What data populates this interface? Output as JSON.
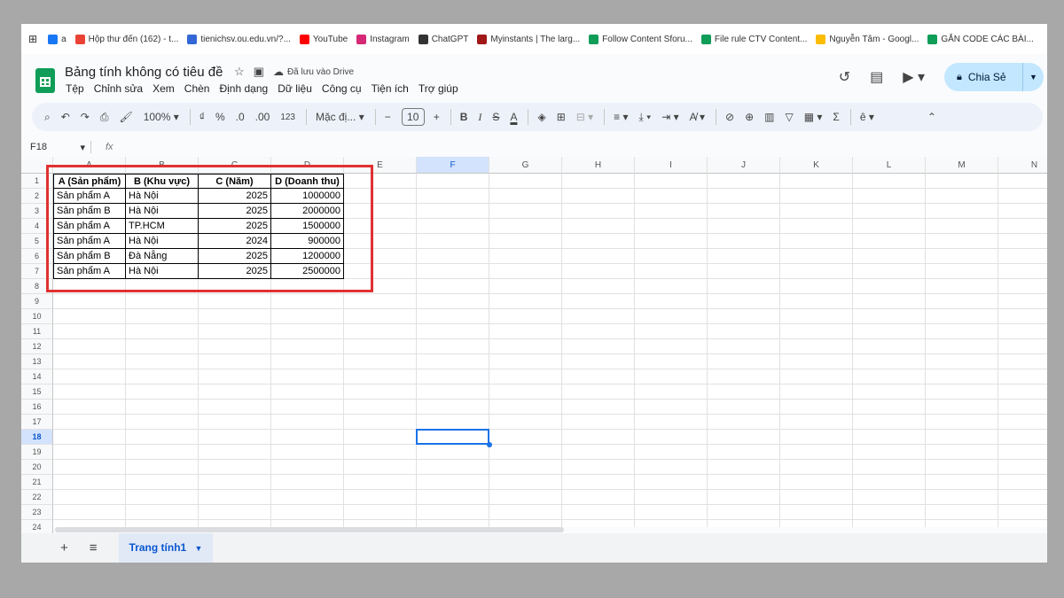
{
  "bookmarks": [
    {
      "label": "a",
      "color": "#1877f2"
    },
    {
      "label": "Hộp thư đến (162) - t...",
      "color": "#ea4335"
    },
    {
      "label": "tienichsv.ou.edu.vn/?...",
      "color": "#3367d6"
    },
    {
      "label": "YouTube",
      "color": "#ff0000"
    },
    {
      "label": "Instagram",
      "color": "#d62976"
    },
    {
      "label": "ChatGPT",
      "color": "#333333"
    },
    {
      "label": "Myinstants | The larg...",
      "color": "#a01818"
    },
    {
      "label": "Follow Content Sforu...",
      "color": "#0f9d58"
    },
    {
      "label": "File rule CTV Content...",
      "color": "#0f9d58"
    },
    {
      "label": "Nguyễn Tâm - Googl...",
      "color": "#fbbc04"
    },
    {
      "label": "GẮN CODE CÁC BÀI...",
      "color": "#0f9d58"
    }
  ],
  "doc": {
    "title": "Bảng tính không có tiêu đề",
    "saved_status": "Đã lưu vào Drive"
  },
  "menu": [
    "Tệp",
    "Chỉnh sửa",
    "Xem",
    "Chèn",
    "Định dạng",
    "Dữ liệu",
    "Công cụ",
    "Tiện ích",
    "Trợ giúp"
  ],
  "share_label": "Chia Sẻ",
  "toolbar": {
    "zoom": "100%",
    "currency": "₫",
    "percent": "%",
    "dec_decrease": ".0",
    "dec_increase": ".00",
    "number_format": "123",
    "font": "Mặc đị...",
    "font_size": "10"
  },
  "formula_bar": {
    "name_box": "F18",
    "fx": "fx"
  },
  "columns": [
    "A",
    "B",
    "C",
    "D",
    "E",
    "F",
    "G",
    "H",
    "I",
    "J",
    "K",
    "L",
    "M",
    "N"
  ],
  "selected_col": "F",
  "rows": [
    "1",
    "2",
    "3",
    "4",
    "5",
    "6",
    "7",
    "8",
    "9",
    "10",
    "11",
    "12",
    "13",
    "14",
    "15",
    "16",
    "17",
    "18",
    "19",
    "20",
    "21",
    "22",
    "23",
    "24"
  ],
  "selected_row": "18",
  "table": {
    "headers": [
      "A (Sản phẩm)",
      "B (Khu vực)",
      "C (Năm)",
      "D (Doanh thu)"
    ],
    "data": [
      [
        "Sản phẩm A",
        "Hà Nội",
        "2025",
        "1000000"
      ],
      [
        "Sản phẩm B",
        "Hà Nội",
        "2025",
        "2000000"
      ],
      [
        "Sản phẩm A",
        "TP.HCM",
        "2025",
        "1500000"
      ],
      [
        "Sản phẩm A",
        "Hà Nội",
        "2024",
        "900000"
      ],
      [
        "Sản phẩm B",
        "Đà Nẵng",
        "2025",
        "1200000"
      ],
      [
        "Sản phẩm A",
        "Hà Nội",
        "2025",
        "2500000"
      ]
    ]
  },
  "sheet_tab": "Trang tính1",
  "colors": {
    "highlight": "#e03131",
    "accent": "#0b57d0",
    "share_bg": "#c2e7ff"
  }
}
